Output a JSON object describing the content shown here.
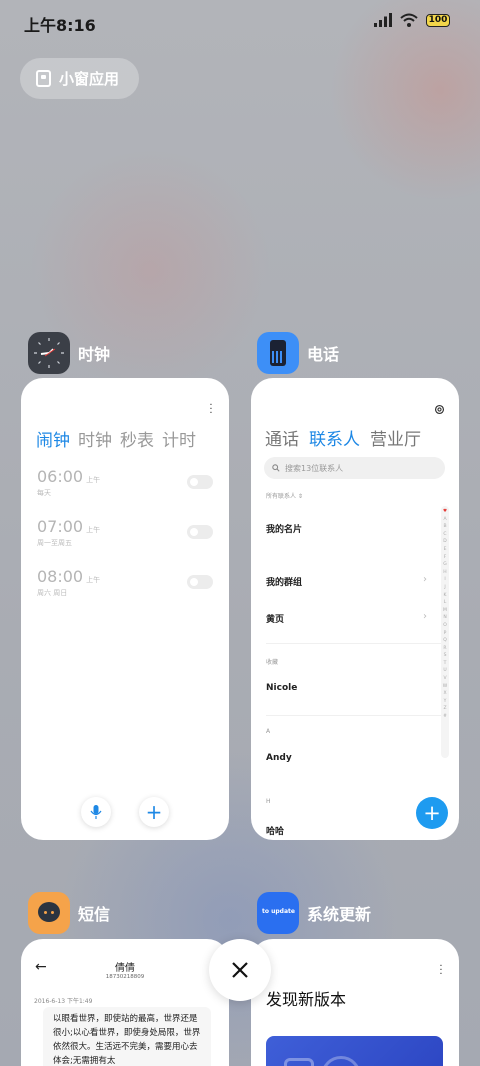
{
  "status": {
    "time": "上午8:16",
    "battery": "100"
  },
  "floating": {
    "label": "小窗应用"
  },
  "apps": {
    "clock": {
      "name": "时钟",
      "tabs": [
        "闹钟",
        "时钟",
        "秒表",
        "计时"
      ],
      "alarms": [
        {
          "time": "06:00",
          "ampm": "上午",
          "days": "每天"
        },
        {
          "time": "07:00",
          "ampm": "上午",
          "days": "周一至周五"
        },
        {
          "time": "08:00",
          "ampm": "上午",
          "days": "周六 周日"
        }
      ]
    },
    "phone": {
      "name": "电话",
      "tabs": [
        "通话",
        "联系人",
        "营业厅"
      ],
      "search_placeholder": "搜索13位联系人",
      "all_contacts": "所有联系人",
      "my_card": "我的名片",
      "my_groups": "我的群组",
      "yellow_pages": "黄页",
      "favorites_header": "收藏",
      "favorite_1": "Nicole",
      "section_a": "A",
      "contact_a": "Andy",
      "section_h": "H",
      "contact_h": "哈哈",
      "index": [
        "♥",
        "A",
        "B",
        "C",
        "D",
        "E",
        "F",
        "G",
        "H",
        "I",
        "J",
        "K",
        "L",
        "M",
        "N",
        "O",
        "P",
        "Q",
        "R",
        "S",
        "T",
        "U",
        "V",
        "W",
        "X",
        "Y",
        "Z",
        "#"
      ]
    },
    "sms": {
      "name": "短信",
      "contact": "倩倩",
      "number": "18730218809",
      "date": "2016-6-13 下午1:49",
      "message": "以眼看世界，即使站的最高，世界还是很小;以心看世界，即使身处局限，世界依然很大。生活远不完美，需要用心去体会;无需拥有太"
    },
    "update": {
      "name": "系统更新",
      "icon_text": "to update",
      "title": "发现新版本"
    }
  },
  "colors": {
    "accent": "#1e88e5",
    "fab": "#1e9bf0"
  }
}
